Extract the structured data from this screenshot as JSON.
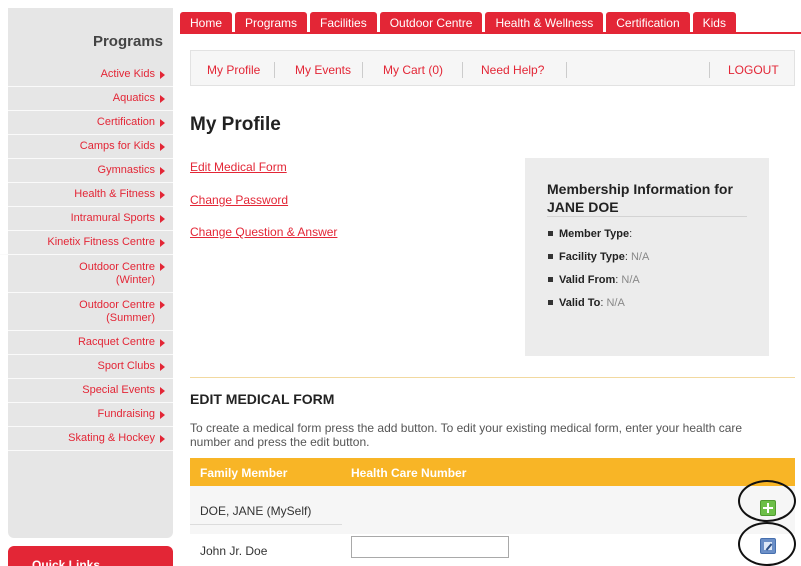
{
  "sidebar": {
    "title": "Programs",
    "items": [
      {
        "label": "Active Kids"
      },
      {
        "label": "Aquatics"
      },
      {
        "label": "Certification"
      },
      {
        "label": "Camps for Kids"
      },
      {
        "label": "Gymnastics"
      },
      {
        "label": "Health & Fitness"
      },
      {
        "label": "Intramural Sports"
      },
      {
        "label": "Kinetix Fitness Centre"
      },
      {
        "label": "Outdoor Centre",
        "label2": "(Winter)"
      },
      {
        "label": "Outdoor Centre",
        "label2": "(Summer)"
      },
      {
        "label": "Racquet Centre"
      },
      {
        "label": "Sport Clubs"
      },
      {
        "label": "Special Events"
      },
      {
        "label": "Fundraising"
      },
      {
        "label": "Skating & Hockey"
      }
    ],
    "quick_links": "Quick Links"
  },
  "topnav": [
    "Home",
    "Programs",
    "Facilities",
    "Outdoor Centre",
    "Health & Wellness",
    "Certification",
    "Kids"
  ],
  "subnav": {
    "my_profile": "My Profile",
    "my_events": "My Events",
    "my_cart": "My Cart (0)",
    "need_help": "Need Help?",
    "logout": "LOGOUT"
  },
  "page_title": "My Profile",
  "links": {
    "edit_medical": "Edit Medical Form",
    "change_password": "Change Password",
    "change_qa": "Change Question & Answer"
  },
  "membership": {
    "title_line1": "Membership Information for",
    "title_line2": "JANE DOE",
    "member_type_label": "Member Type",
    "member_type_value": "",
    "facility_type_label": "Facility Type",
    "facility_type_value": "N/A",
    "valid_from_label": "Valid From",
    "valid_from_value": "N/A",
    "valid_to_label": "Valid To",
    "valid_to_value": "N/A"
  },
  "medical": {
    "section_title": "EDIT MEDICAL FORM",
    "instructions": "To create a medical form press the add button. To edit your existing medical form, enter your health care number and press the edit button.",
    "col_family": "Family Member",
    "col_health": "Health Care Number",
    "rows": [
      {
        "name": "DOE, JANE (MySelf)"
      },
      {
        "name": "John Jr. Doe",
        "health_value": ""
      }
    ]
  },
  "colors": {
    "brand_red": "#e32636",
    "table_header": "#f8b526"
  }
}
